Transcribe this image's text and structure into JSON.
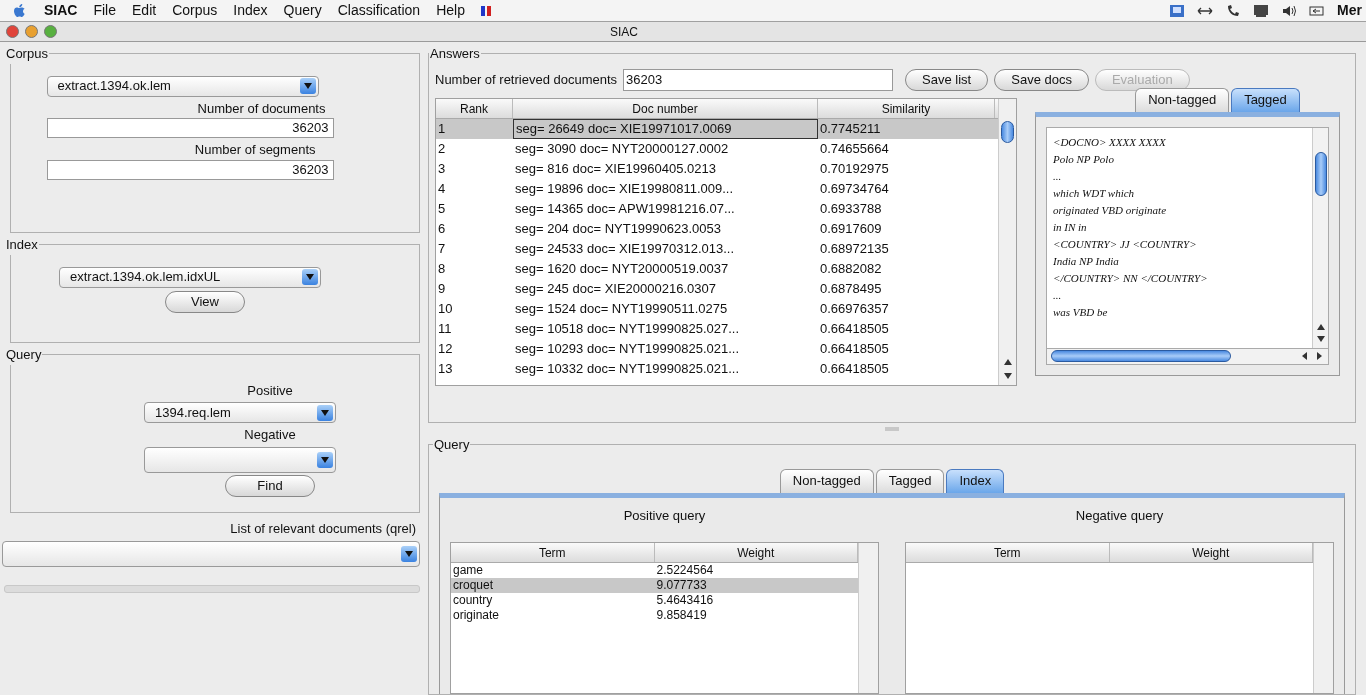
{
  "menubar": {
    "app": "SIAC",
    "items": [
      "File",
      "Edit",
      "Corpus",
      "Index",
      "Query",
      "Classification",
      "Help"
    ],
    "right_text": "Mer"
  },
  "window": {
    "title": "SIAC"
  },
  "corpus": {
    "legend": "Corpus",
    "select": "extract.1394.ok.lem",
    "docs_label": "Number of documents",
    "docs_value": "36203",
    "segs_label": "Number of segments",
    "segs_value": "36203"
  },
  "index": {
    "legend": "Index",
    "select": "extract.1394.ok.lem.idxUL",
    "button": "View"
  },
  "query_form": {
    "legend": "Query",
    "positive_label": "Positive",
    "positive_value": "1394.req.lem",
    "negative_label": "Negative",
    "button": "Find"
  },
  "qrel": {
    "label": "List of relevant documents (qrel)"
  },
  "progress": {
    "level": 0
  },
  "answers": {
    "legend": "Answers",
    "count_label": "Number of retrieved documents",
    "count_value": "36203",
    "buttons": [
      {
        "label": "Save list",
        "disabled": false
      },
      {
        "label": "Save docs",
        "disabled": false
      },
      {
        "label": "Evaluation",
        "disabled": true
      }
    ],
    "columns": [
      "Rank",
      "Doc number",
      "Similarity"
    ],
    "rows": [
      {
        "cells": [
          "1",
          "seg= 26649 doc= XIE19971017.0069",
          "0.7745211"
        ],
        "selected": true
      },
      {
        "cells": [
          "2",
          "seg= 3090 doc= NYT20000127.0002",
          "0.74655664"
        ],
        "selected": false
      },
      {
        "cells": [
          "3",
          "seg= 816 doc= XIE19960405.0213",
          "0.70192975"
        ],
        "selected": false
      },
      {
        "cells": [
          "4",
          "seg= 19896 doc= XIE19980811.009...",
          "0.69734764"
        ],
        "selected": false
      },
      {
        "cells": [
          "5",
          "seg= 14365 doc= APW19981216.07...",
          "0.6933788"
        ],
        "selected": false
      },
      {
        "cells": [
          "6",
          "seg= 204 doc= NYT19990623.0053",
          "0.6917609"
        ],
        "selected": false
      },
      {
        "cells": [
          "7",
          "seg= 24533 doc= XIE19970312.013...",
          "0.68972135"
        ],
        "selected": false
      },
      {
        "cells": [
          "8",
          "seg= 1620 doc= NYT20000519.0037",
          "0.6882082"
        ],
        "selected": false
      },
      {
        "cells": [
          "9",
          "seg= 245 doc= XIE20000216.0307",
          "0.6878495"
        ],
        "selected": false
      },
      {
        "cells": [
          "10",
          "seg= 1524 doc= NYT19990511.0275",
          "0.66976357"
        ],
        "selected": false
      },
      {
        "cells": [
          "11",
          "seg= 10518 doc= NYT19990825.027...",
          "0.66418505"
        ],
        "selected": false
      },
      {
        "cells": [
          "12",
          "seg= 10293 doc= NYT19990825.021...",
          "0.66418505"
        ],
        "selected": false
      },
      {
        "cells": [
          "13",
          "seg= 10332 doc= NYT19990825.021...",
          "0.66418505"
        ],
        "selected": false
      }
    ],
    "tabs": [
      {
        "label": "Non-tagged",
        "selected": false
      },
      {
        "label": "Tagged",
        "selected": true
      }
    ],
    "tagged_lines": [
      "<DOCNO> XXXX XXXX",
      "Polo NP Polo",
      "...",
      "which WDT which",
      "originated VBD originate",
      "in IN in",
      "<COUNTRY> JJ <COUNTRY>",
      "India NP India",
      "</COUNTRY> NN </COUNTRY>",
      "...",
      "was VBD be"
    ]
  },
  "query": {
    "legend": "Query",
    "tabs": [
      {
        "label": "Non-tagged",
        "selected": false
      },
      {
        "label": "Tagged",
        "selected": false
      },
      {
        "label": "Index",
        "selected": true
      }
    ],
    "positive": {
      "title": "Positive query",
      "columns": [
        "Term",
        "Weight"
      ],
      "rows": [
        {
          "term": "game",
          "weight": "2.5224564",
          "selected": false
        },
        {
          "term": "croquet",
          "weight": "9.077733",
          "selected": true
        },
        {
          "term": "country",
          "weight": "5.4643416",
          "selected": false
        },
        {
          "term": "originate",
          "weight": "9.858419",
          "selected": false
        }
      ]
    },
    "negative": {
      "title": "Negative query",
      "columns": [
        "Term",
        "Weight"
      ]
    }
  }
}
